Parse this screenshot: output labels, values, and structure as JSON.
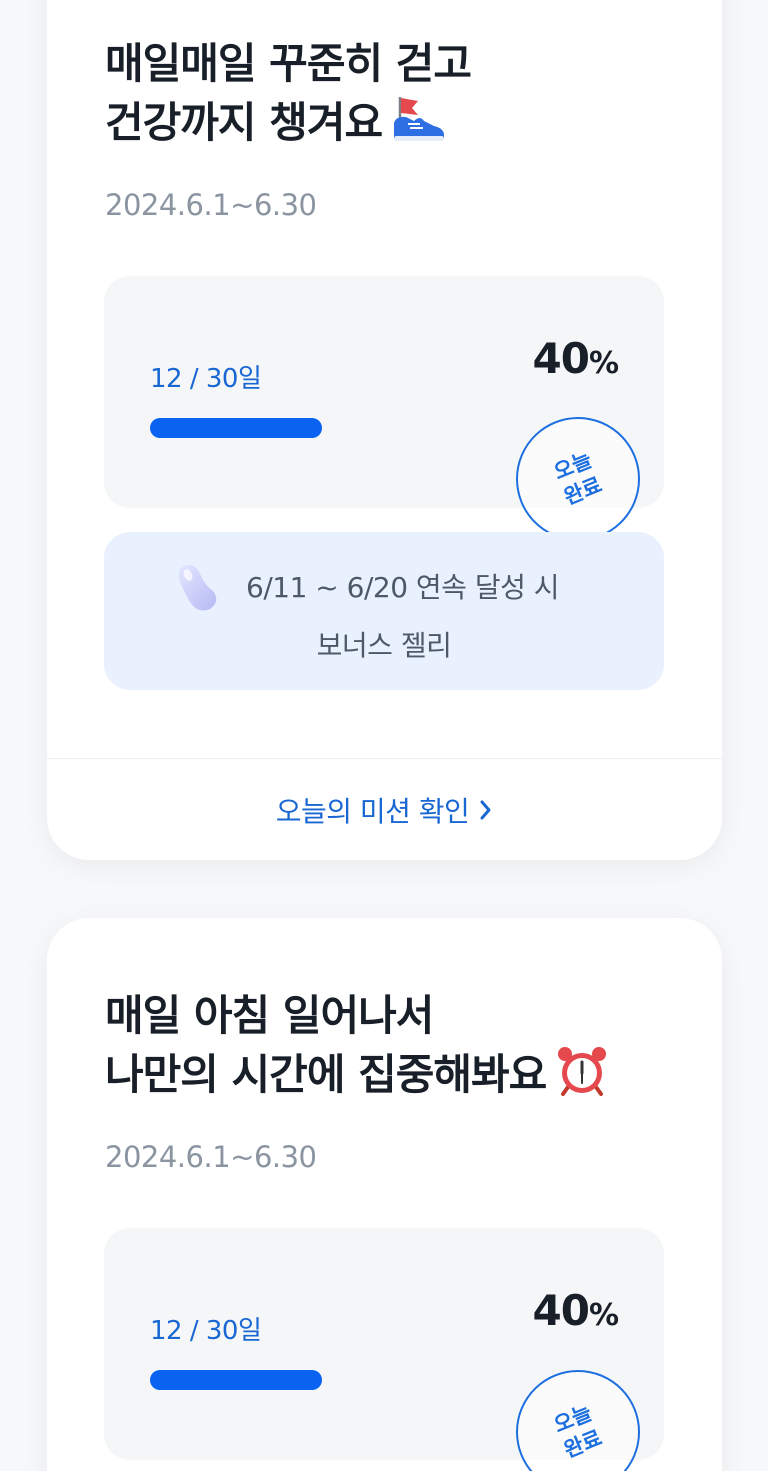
{
  "colors": {
    "accent": "#1967d2",
    "progress_fill": "#0a62f0",
    "bonus_bg": "#e9f1fe",
    "box_bg": "#f4f6f8",
    "muted_text": "#8b95a1"
  },
  "challenges": [
    {
      "title_line1": "매일매일 꾸준히 걷고",
      "title_line2": "건강까지 챙겨요",
      "title_icon": "running-shoe-icon",
      "period": "2024.6.1~6.30",
      "progress_days": "12 / 30일",
      "progress_percent": "40",
      "progress_unit": "%",
      "progress_fraction": 0.4,
      "stamp_line1": "오늘",
      "stamp_line2": "완료",
      "bonus_icon": "jelly-bean-icon",
      "bonus_condition": "6/11 ~ 6/20 연속 달성 시",
      "bonus_reward": "보너스 젤리",
      "mission_link": "오늘의 미션 확인"
    },
    {
      "title_line1": "매일 아침 일어나서",
      "title_line2": "나만의 시간에 집중해봐요",
      "title_icon": "alarm-clock-icon",
      "period": "2024.6.1~6.30",
      "progress_days": "12 / 30일",
      "progress_percent": "40",
      "progress_unit": "%",
      "progress_fraction": 0.4,
      "stamp_line1": "오늘",
      "stamp_line2": "완료"
    }
  ]
}
